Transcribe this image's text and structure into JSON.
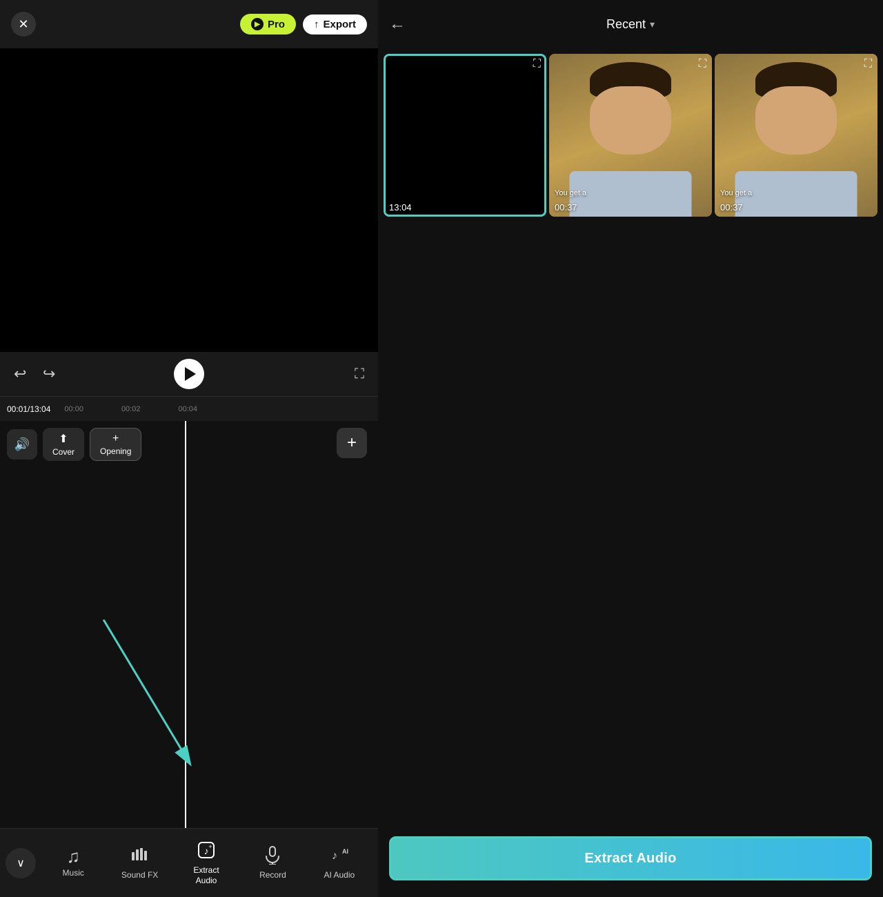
{
  "header": {
    "close_label": "✕",
    "pro_label": "Pro",
    "export_label": "Export",
    "pro_icon": "▶"
  },
  "playback": {
    "current_time": "00:01",
    "total_time": "13:04",
    "ruler_marks": [
      "00:00",
      "00:02",
      "00:04"
    ]
  },
  "timeline": {
    "sound_icon": "🔊",
    "cover_label": "Cover",
    "cover_icon": "⬆",
    "opening_label": "Opening",
    "opening_icon": "+",
    "add_icon": "+"
  },
  "bottom_nav": {
    "collapse_icon": "∨",
    "items": [
      {
        "id": "music",
        "icon": "♫",
        "label": "Music"
      },
      {
        "id": "sound-fx",
        "icon": "📊",
        "label": "Sound FX"
      },
      {
        "id": "extract-audio",
        "icon": "🎵",
        "label": "Extract\nAudio",
        "active": true
      },
      {
        "id": "record",
        "icon": "🎙",
        "label": "Record"
      },
      {
        "id": "ai-audio",
        "icon": "♪",
        "label": "AI Audio"
      }
    ]
  },
  "right_panel": {
    "back_icon": "←",
    "title": "Recent",
    "dropdown_icon": "▾",
    "media_items": [
      {
        "id": "thumb-1",
        "duration": "13:04",
        "subtitle": "",
        "selected": true,
        "type": "black"
      },
      {
        "id": "thumb-2",
        "duration": "00:37",
        "subtitle": "You get a",
        "selected": false,
        "type": "person"
      },
      {
        "id": "thumb-3",
        "duration": "00:37",
        "subtitle": "You get a",
        "selected": false,
        "type": "person"
      }
    ],
    "extract_button_label": "Extract Audio"
  }
}
